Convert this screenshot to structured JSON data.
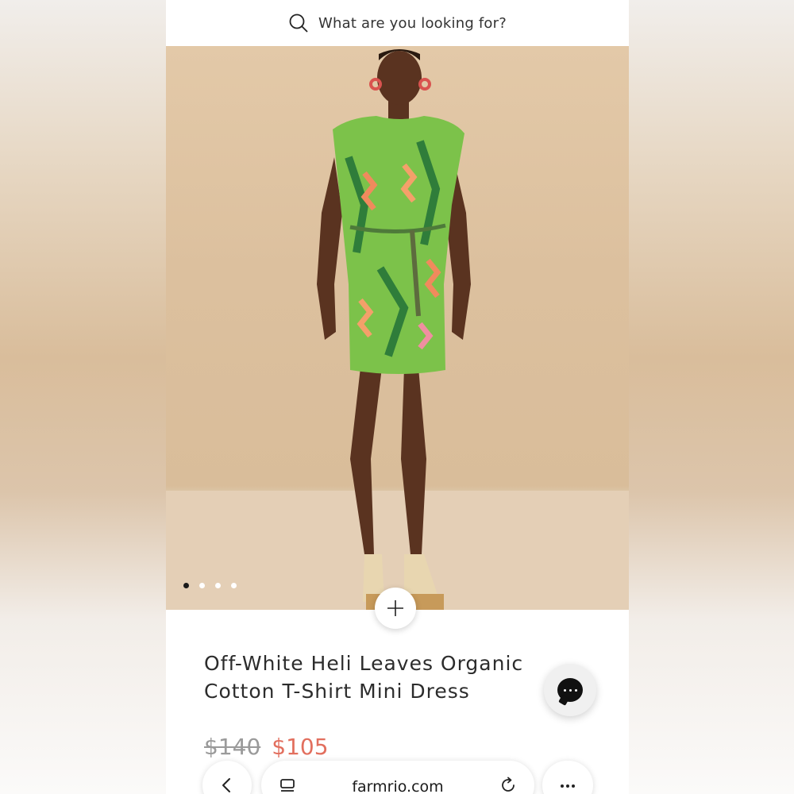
{
  "search": {
    "placeholder": "What are you looking for?"
  },
  "product": {
    "title_line1": "Off-White Heli Leaves Organic",
    "title_line2": "Cotton T-Shirt Mini Dress",
    "price_original": "$140",
    "price_sale": "$105",
    "image_count": 4,
    "active_image": 1
  },
  "browser": {
    "url": "farmrio.com"
  },
  "colors": {
    "sale_price": "#e26f5e",
    "backdrop": "#dcc09e"
  },
  "icons": [
    "search-icon",
    "plus-icon",
    "chat-icon",
    "back-icon",
    "tabs-icon",
    "reload-icon",
    "more-icon"
  ]
}
